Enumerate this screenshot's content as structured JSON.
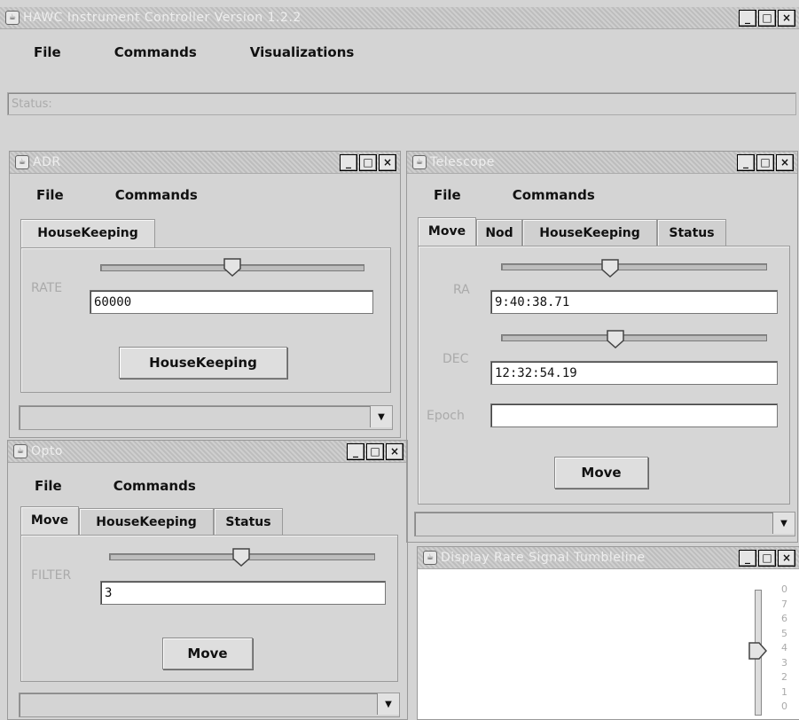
{
  "main_window": {
    "title": "HAWC Instrument Controller Version 1.2.2",
    "menu": [
      "File",
      "Commands",
      "Visualizations"
    ],
    "status_label": "Status:"
  },
  "adr_window": {
    "title": "ADR",
    "menu": [
      "File",
      "Commands"
    ],
    "tabs": [
      "HouseKeeping"
    ],
    "rate_label": "RATE",
    "rate_value": "60000",
    "button": "HouseKeeping",
    "slider_fraction": 0.5
  },
  "opto_window": {
    "title": "Opto",
    "menu": [
      "File",
      "Commands"
    ],
    "tabs": [
      "Move",
      "HouseKeeping",
      "Status"
    ],
    "filter_label": "FILTER",
    "filter_value": "3",
    "button": "Move",
    "slider_fraction": 0.5
  },
  "telescope_window": {
    "title": "Telescope",
    "menu": [
      "File",
      "Commands"
    ],
    "tabs": [
      "Move",
      "Nod",
      "HouseKeeping",
      "Status"
    ],
    "ra_label": "RA",
    "ra_value": "9:40:38.71",
    "dec_label": "DEC",
    "dec_value": "12:32:54.19",
    "epoch_label": "Epoch",
    "epoch_value": "",
    "button": "Move",
    "ra_slider_fraction": 0.4,
    "dec_slider_fraction": 0.42
  },
  "display_window": {
    "title": "Display Rate Signal Tumbleline",
    "scale_ticks": [
      "0",
      "7",
      "6",
      "5",
      "4",
      "3",
      "2",
      "1",
      "0"
    ]
  },
  "icons": {
    "window_icon": "java-cup-icon",
    "minimize": "minimize-icon",
    "maximize": "maximize-icon",
    "close": "close-icon",
    "dropdown": "chevron-down-icon"
  }
}
